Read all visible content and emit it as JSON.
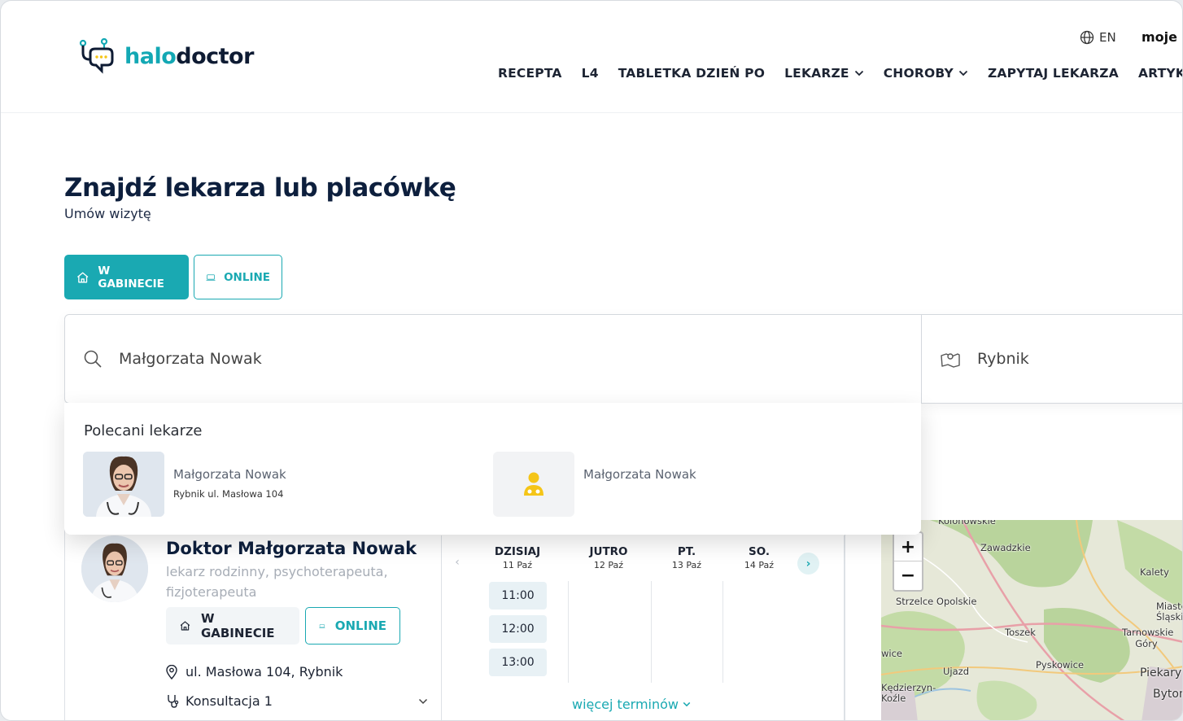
{
  "header": {
    "logo": {
      "part1": "halo",
      "part2": "doctor"
    },
    "lang": "EN",
    "account": "moje",
    "nav": [
      {
        "label": "RECEPTA",
        "dropdown": false
      },
      {
        "label": "L4",
        "dropdown": false
      },
      {
        "label": "TABLETKA DZIEŃ PO",
        "dropdown": false
      },
      {
        "label": "LEKARZE",
        "dropdown": true
      },
      {
        "label": "CHOROBY",
        "dropdown": true
      },
      {
        "label": "ZAPYTAJ LEKARZA",
        "dropdown": false
      },
      {
        "label": "ARTYKUŁY",
        "dropdown": false
      }
    ]
  },
  "hero": {
    "title": "Znajdź lekarza lub placówkę",
    "subtitle": "Umów wizytę"
  },
  "mode": {
    "office": "W GABINECIE",
    "online": "ONLINE",
    "selected": "office"
  },
  "search": {
    "query": "Małgorzata Nowak",
    "city": "Rybnik"
  },
  "suggestions": {
    "title": "Polecani lekarze",
    "items": [
      {
        "name": "Małgorzata Nowak",
        "address": "Rybnik ul. Masłowa 104"
      },
      {
        "name": "Małgorzata Nowak",
        "address": ""
      }
    ]
  },
  "doctor": {
    "name": "Doktor Małgorzata Nowak",
    "specialties": "lekarz rodzinny, psychoterapeuta, fizjoterapeuta",
    "office_label": "W GABINECIE",
    "online_label": "ONLINE",
    "address": "ul. Masłowa 104, Rybnik",
    "consultation": "Konsultacja 1"
  },
  "calendar": {
    "days": [
      {
        "name": "DZISIAJ",
        "date": "11 Paź",
        "slots": [
          "11:00",
          "12:00",
          "13:00"
        ]
      },
      {
        "name": "JUTRO",
        "date": "12 Paź",
        "slots": []
      },
      {
        "name": "PT.",
        "date": "13 Paź",
        "slots": []
      },
      {
        "name": "SO.",
        "date": "14 Paź",
        "slots": []
      }
    ],
    "more_label": "więcej terminów"
  },
  "map": {
    "labels": [
      "Kolonowskie",
      "Zawadzkie",
      "Kalety",
      "Strzelce Opolskie",
      "Miasteczko Śląskie",
      "Toszek",
      "Tarnowskie Góry",
      "Pyskowice",
      "Ujazd",
      "Piekary",
      "Bytom",
      "Kędzierzyn-Koźle",
      "wice"
    ],
    "zoom_in": "+",
    "zoom_out": "−"
  },
  "colors": {
    "accent": "#1aa9b2",
    "dark": "#0d1f3d",
    "placeholder_icon": "#f5c518"
  }
}
